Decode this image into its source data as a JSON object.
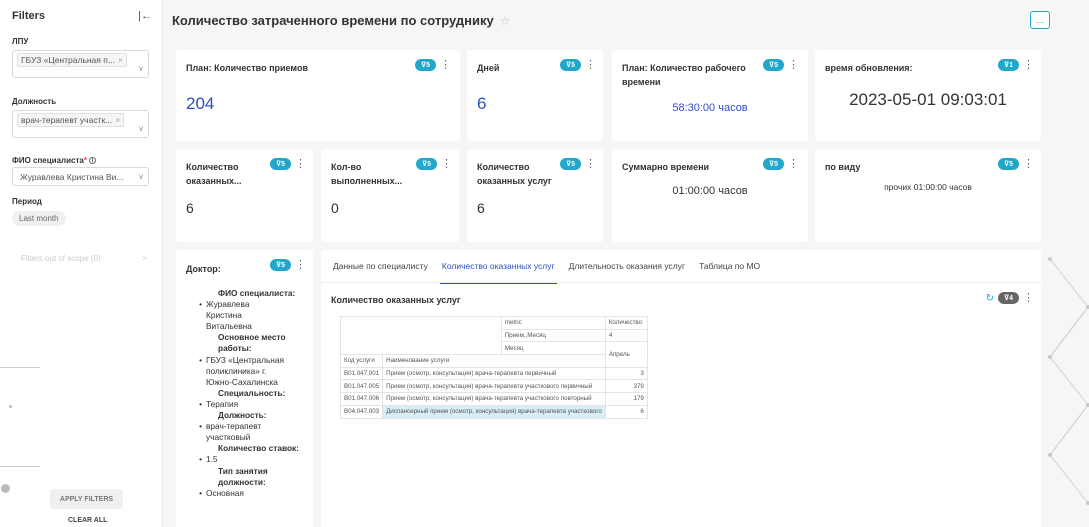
{
  "sidebar": {
    "title": "Filters",
    "filters": [
      {
        "label": "ЛПУ",
        "tag": "ГБУЗ «Центральная п..."
      },
      {
        "label": "Должность",
        "tag": "врач-терапевт участк..."
      },
      {
        "label": "ФИО специалиста",
        "value": "Журавлева Кристина Ви..."
      },
      {
        "label": "Период",
        "value": "Last month"
      }
    ],
    "out_of_scope": "Filters out of scope (0)",
    "apply_label": "APPLY FILTERS",
    "clear_label": "CLEAR ALL"
  },
  "header": {
    "title": "Количество затраченного времени по сотруднику",
    "more": "..."
  },
  "cards": {
    "plan_visits": {
      "title": "План: Количество приемов",
      "value": "204",
      "badge": "5"
    },
    "days": {
      "title": "Дней",
      "value": "6",
      "badge": "5"
    },
    "plan_time": {
      "title": "План: Количество рабочего времени",
      "value": "58:30:00 часов",
      "badge": "5"
    },
    "update_time": {
      "title": "время обновления:",
      "value": "2023-05-01 09:03:01",
      "badge": "1"
    },
    "rendered": {
      "title": "Количество оказанных...",
      "value": "6",
      "badge": "5"
    },
    "performed": {
      "title": "Кол-во выполненных...",
      "value": "0",
      "badge": "5"
    },
    "services": {
      "title": "Количество оказанных услуг",
      "value": "6",
      "badge": "5"
    },
    "total_time": {
      "title": "Суммарно времени",
      "value": "01:00:00 часов",
      "badge": "5"
    },
    "by_type": {
      "title": "по виду",
      "value": "прочих 01:00:00 часов",
      "badge": "5"
    }
  },
  "doctor": {
    "title": "Доктор:",
    "badge": "5",
    "sections": [
      {
        "head": "ФИО специалиста:",
        "lines": [
          "Журавлева",
          "Кристина",
          "Витальевна"
        ]
      },
      {
        "head": "Основное место работы:",
        "lines": [
          "ГБУЗ «Центральная",
          "поликлиника» г.",
          "Южно-Сахалинска"
        ]
      },
      {
        "head": "Специальность:",
        "lines": [
          "Терапия"
        ]
      },
      {
        "head": "Должность:",
        "lines": [
          "врач-терапевт",
          "участковый"
        ]
      },
      {
        "head": "Количество ставок:",
        "lines": [
          "1.5"
        ]
      },
      {
        "head": "Тип занятия должности:",
        "lines": [
          "Основная"
        ]
      }
    ]
  },
  "panel": {
    "tabs": [
      "Данные по специалисту",
      "Количество оказанных услуг",
      "Длительность оказания услуг",
      "Таблица по МО"
    ],
    "active_tab": 1,
    "subtitle": "Количество оказанных услуг",
    "badge": "4",
    "table": {
      "metric_label": "metric",
      "metric_value": "Количество",
      "row_header_1": "Прием,,Месяц",
      "row_value_1": "4",
      "row_header_2": "Месяц",
      "month": "Апрель",
      "col_code": "Код услуги",
      "col_name": "Наименование услуги",
      "rows": [
        {
          "code": "B01.047.001",
          "name": "Прием (осмотр, консультация) врача-терапевта первичный",
          "value": "3"
        },
        {
          "code": "B01.047.005",
          "name": "Прием (осмотр, консультация) врача-терапевта участкового первичный",
          "value": "379"
        },
        {
          "code": "B01.047.006",
          "name": "Прием (осмотр, консультация) врача-терапевта участкового повторный",
          "value": "179"
        },
        {
          "code": "B04.047.003",
          "name": "Диспансерный прием (осмотр, консультация) врача-терапевта участкового",
          "value": "6"
        }
      ]
    }
  },
  "colors": {
    "accent": "#20a7c9",
    "link": "#2d4ec5",
    "badge_grey": "#666666"
  }
}
